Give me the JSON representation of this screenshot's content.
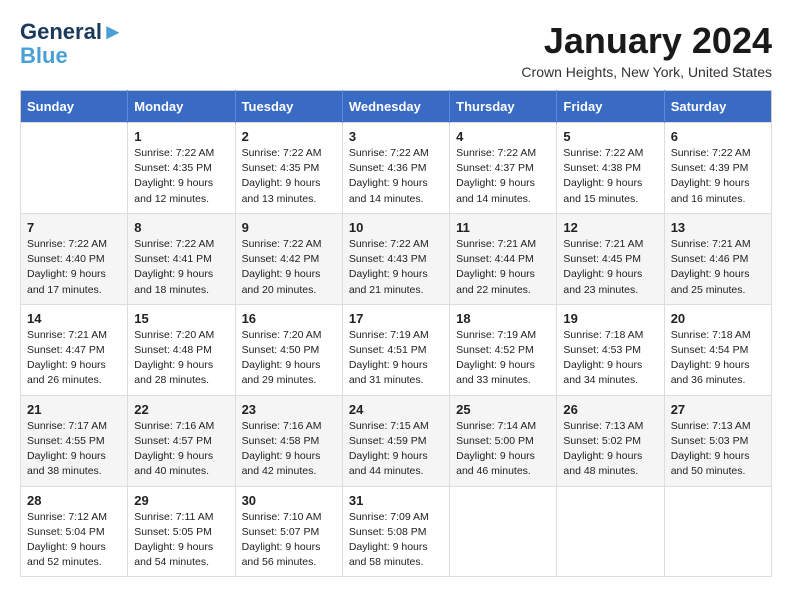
{
  "header": {
    "logo_line1": "General",
    "logo_line2": "Blue",
    "month_title": "January 2024",
    "location": "Crown Heights, New York, United States"
  },
  "days_of_week": [
    "Sunday",
    "Monday",
    "Tuesday",
    "Wednesday",
    "Thursday",
    "Friday",
    "Saturday"
  ],
  "weeks": [
    [
      {
        "num": "",
        "info": ""
      },
      {
        "num": "1",
        "info": "Sunrise: 7:22 AM\nSunset: 4:35 PM\nDaylight: 9 hours\nand 12 minutes."
      },
      {
        "num": "2",
        "info": "Sunrise: 7:22 AM\nSunset: 4:35 PM\nDaylight: 9 hours\nand 13 minutes."
      },
      {
        "num": "3",
        "info": "Sunrise: 7:22 AM\nSunset: 4:36 PM\nDaylight: 9 hours\nand 14 minutes."
      },
      {
        "num": "4",
        "info": "Sunrise: 7:22 AM\nSunset: 4:37 PM\nDaylight: 9 hours\nand 14 minutes."
      },
      {
        "num": "5",
        "info": "Sunrise: 7:22 AM\nSunset: 4:38 PM\nDaylight: 9 hours\nand 15 minutes."
      },
      {
        "num": "6",
        "info": "Sunrise: 7:22 AM\nSunset: 4:39 PM\nDaylight: 9 hours\nand 16 minutes."
      }
    ],
    [
      {
        "num": "7",
        "info": "Sunrise: 7:22 AM\nSunset: 4:40 PM\nDaylight: 9 hours\nand 17 minutes."
      },
      {
        "num": "8",
        "info": "Sunrise: 7:22 AM\nSunset: 4:41 PM\nDaylight: 9 hours\nand 18 minutes."
      },
      {
        "num": "9",
        "info": "Sunrise: 7:22 AM\nSunset: 4:42 PM\nDaylight: 9 hours\nand 20 minutes."
      },
      {
        "num": "10",
        "info": "Sunrise: 7:22 AM\nSunset: 4:43 PM\nDaylight: 9 hours\nand 21 minutes."
      },
      {
        "num": "11",
        "info": "Sunrise: 7:21 AM\nSunset: 4:44 PM\nDaylight: 9 hours\nand 22 minutes."
      },
      {
        "num": "12",
        "info": "Sunrise: 7:21 AM\nSunset: 4:45 PM\nDaylight: 9 hours\nand 23 minutes."
      },
      {
        "num": "13",
        "info": "Sunrise: 7:21 AM\nSunset: 4:46 PM\nDaylight: 9 hours\nand 25 minutes."
      }
    ],
    [
      {
        "num": "14",
        "info": "Sunrise: 7:21 AM\nSunset: 4:47 PM\nDaylight: 9 hours\nand 26 minutes."
      },
      {
        "num": "15",
        "info": "Sunrise: 7:20 AM\nSunset: 4:48 PM\nDaylight: 9 hours\nand 28 minutes."
      },
      {
        "num": "16",
        "info": "Sunrise: 7:20 AM\nSunset: 4:50 PM\nDaylight: 9 hours\nand 29 minutes."
      },
      {
        "num": "17",
        "info": "Sunrise: 7:19 AM\nSunset: 4:51 PM\nDaylight: 9 hours\nand 31 minutes."
      },
      {
        "num": "18",
        "info": "Sunrise: 7:19 AM\nSunset: 4:52 PM\nDaylight: 9 hours\nand 33 minutes."
      },
      {
        "num": "19",
        "info": "Sunrise: 7:18 AM\nSunset: 4:53 PM\nDaylight: 9 hours\nand 34 minutes."
      },
      {
        "num": "20",
        "info": "Sunrise: 7:18 AM\nSunset: 4:54 PM\nDaylight: 9 hours\nand 36 minutes."
      }
    ],
    [
      {
        "num": "21",
        "info": "Sunrise: 7:17 AM\nSunset: 4:55 PM\nDaylight: 9 hours\nand 38 minutes."
      },
      {
        "num": "22",
        "info": "Sunrise: 7:16 AM\nSunset: 4:57 PM\nDaylight: 9 hours\nand 40 minutes."
      },
      {
        "num": "23",
        "info": "Sunrise: 7:16 AM\nSunset: 4:58 PM\nDaylight: 9 hours\nand 42 minutes."
      },
      {
        "num": "24",
        "info": "Sunrise: 7:15 AM\nSunset: 4:59 PM\nDaylight: 9 hours\nand 44 minutes."
      },
      {
        "num": "25",
        "info": "Sunrise: 7:14 AM\nSunset: 5:00 PM\nDaylight: 9 hours\nand 46 minutes."
      },
      {
        "num": "26",
        "info": "Sunrise: 7:13 AM\nSunset: 5:02 PM\nDaylight: 9 hours\nand 48 minutes."
      },
      {
        "num": "27",
        "info": "Sunrise: 7:13 AM\nSunset: 5:03 PM\nDaylight: 9 hours\nand 50 minutes."
      }
    ],
    [
      {
        "num": "28",
        "info": "Sunrise: 7:12 AM\nSunset: 5:04 PM\nDaylight: 9 hours\nand 52 minutes."
      },
      {
        "num": "29",
        "info": "Sunrise: 7:11 AM\nSunset: 5:05 PM\nDaylight: 9 hours\nand 54 minutes."
      },
      {
        "num": "30",
        "info": "Sunrise: 7:10 AM\nSunset: 5:07 PM\nDaylight: 9 hours\nand 56 minutes."
      },
      {
        "num": "31",
        "info": "Sunrise: 7:09 AM\nSunset: 5:08 PM\nDaylight: 9 hours\nand 58 minutes."
      },
      {
        "num": "",
        "info": ""
      },
      {
        "num": "",
        "info": ""
      },
      {
        "num": "",
        "info": ""
      }
    ]
  ]
}
